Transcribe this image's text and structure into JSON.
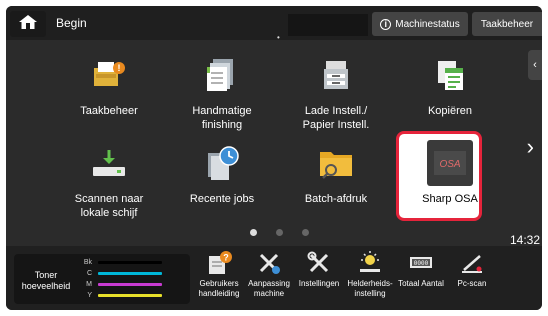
{
  "header": {
    "title": "Begin",
    "status_label": "Machinestatus",
    "task_label": "Taakbeheer"
  },
  "tiles": [
    {
      "label": "Taakbeheer",
      "icon": "job-status-icon"
    },
    {
      "label": "Handmatige finishing",
      "icon": "manual-finishing-icon"
    },
    {
      "label": "Lade Instell./ Papier Instell.",
      "icon": "tray-settings-icon"
    },
    {
      "label": "Kopiëren",
      "icon": "copy-icon"
    },
    {
      "label": "Scannen naar lokale schijf",
      "icon": "scan-to-local-drive-icon"
    },
    {
      "label": "Recente jobs",
      "icon": "recent-jobs-icon"
    },
    {
      "label": "Batch-afdruk",
      "icon": "batch-print-folder-icon"
    },
    {
      "label": "Sharp OSA",
      "icon": "sharp-osa-icon",
      "icon_text": "OSA"
    }
  ],
  "pagination": {
    "pages": 3,
    "current": 1
  },
  "clock": "14:32",
  "toner": {
    "label": "Toner hoeveelheid",
    "levels": [
      {
        "name": "Bk",
        "color": "#000000"
      },
      {
        "name": "C",
        "color": "#00b7d8"
      },
      {
        "name": "M",
        "color": "#c83bd1"
      },
      {
        "name": "Y",
        "color": "#e8e02a"
      }
    ]
  },
  "bottom_tools": [
    {
      "label": "Gebruikers handleiding",
      "icon": "user-manual-icon"
    },
    {
      "label": "Aanpassing machine",
      "icon": "machine-adjust-icon"
    },
    {
      "label": "Instellingen",
      "icon": "settings-tools-icon"
    },
    {
      "label": "Helderheids-instelling",
      "icon": "brightness-icon"
    },
    {
      "label": "Totaal Aantal",
      "icon": "total-count-icon"
    },
    {
      "label": "Pc-scan",
      "icon": "pc-scan-icon"
    }
  ],
  "colors": {
    "accent_selected": "#e5243b",
    "bar": "#1f1f1f",
    "screen": "#2b2b2b"
  }
}
